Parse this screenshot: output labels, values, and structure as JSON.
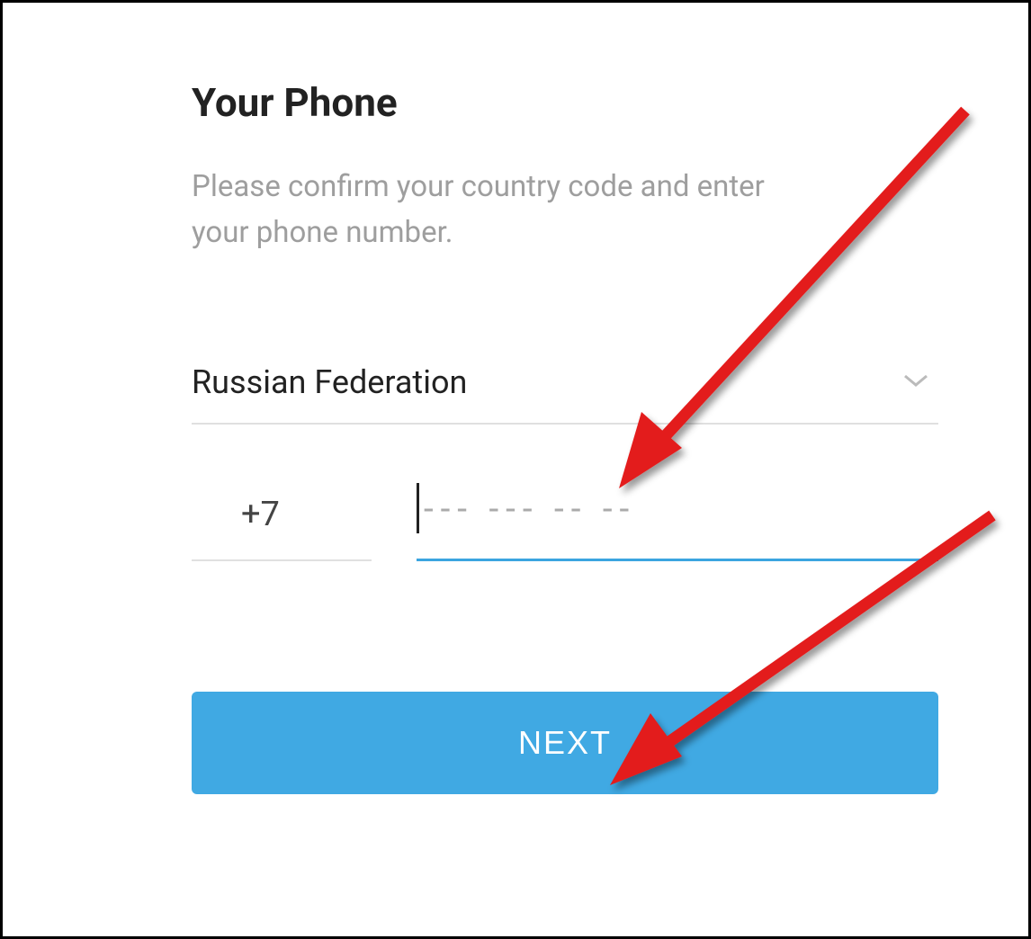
{
  "title": "Your Phone",
  "subtitle": "Please confirm your country code and enter your phone number.",
  "country": {
    "selected": "Russian Federation"
  },
  "phone": {
    "country_code": "+7",
    "placeholder": "--- --- -- --"
  },
  "next_button_label": "NEXT"
}
